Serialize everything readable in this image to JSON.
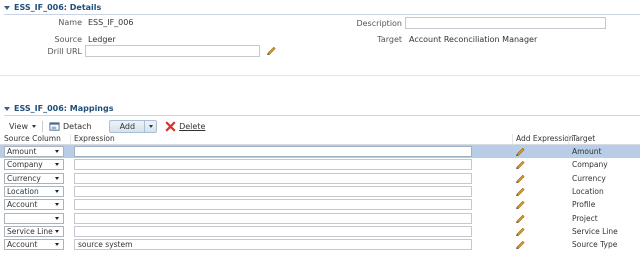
{
  "details": {
    "title": "ESS_IF_006: Details",
    "name_label": "Name",
    "name_value": "ESS_IF_006",
    "source_label": "Source",
    "source_value": "Ledger",
    "drill_url_label": "Drill URL",
    "drill_url_value": "",
    "description_label": "Description",
    "description_value": "",
    "target_label": "Target",
    "target_value": "Account Reconciliation Manager"
  },
  "mappings": {
    "title": "ESS_IF_006: Mappings",
    "toolbar": {
      "view_label": "View",
      "detach_label": "Detach",
      "add_label": "Add",
      "delete_label": "Delete"
    },
    "columns": {
      "source_column": "Source Column",
      "expression": "Expression",
      "add_expression": "Add Expression",
      "target": "Target"
    },
    "rows": [
      {
        "source": "Amount",
        "expression": "",
        "target": "Amount",
        "selected": true
      },
      {
        "source": "Company",
        "expression": "",
        "target": "Company",
        "selected": false
      },
      {
        "source": "Currency",
        "expression": "",
        "target": "Currency",
        "selected": false
      },
      {
        "source": "Location",
        "expression": "",
        "target": "Location",
        "selected": false
      },
      {
        "source": "Account",
        "expression": "",
        "target": "Profile",
        "selected": false
      },
      {
        "source": "",
        "expression": "",
        "target": "Project",
        "selected": false
      },
      {
        "source": "Service Line",
        "expression": "",
        "target": "Service Line",
        "selected": false
      },
      {
        "source": "Account",
        "expression": "source system",
        "target": "Source Type",
        "selected": false
      }
    ]
  },
  "colors": {
    "title_text": "#1f4e79",
    "selected_row": "#b9cee6",
    "delete_icon": "#d9342b"
  },
  "icons": [
    "collapse-triangle-icon",
    "pencil-icon",
    "detach-icon",
    "delete-x-icon",
    "chevron-down-icon"
  ]
}
